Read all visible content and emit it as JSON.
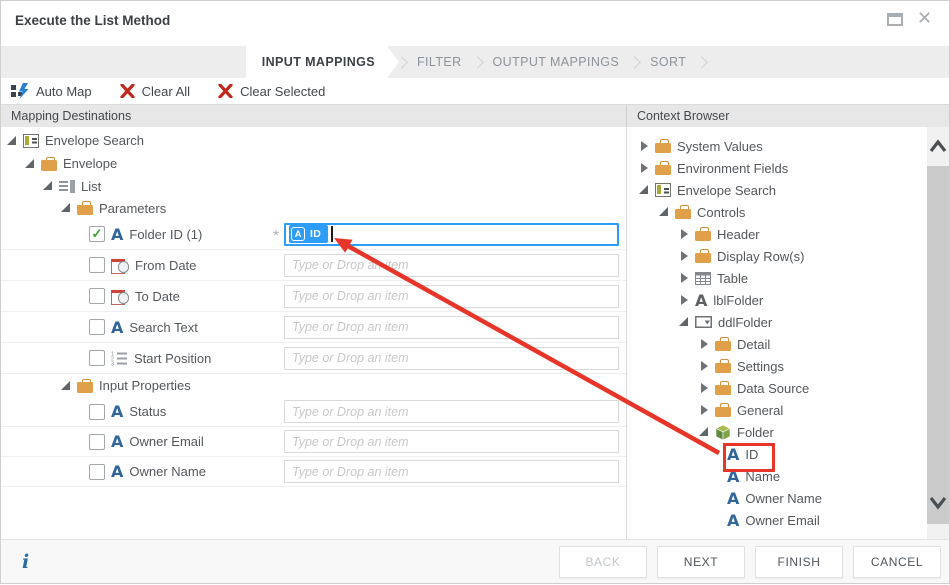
{
  "window": {
    "title": "Execute the List Method"
  },
  "tabs": {
    "items": [
      {
        "label": "INPUT MAPPINGS",
        "active": true
      },
      {
        "label": "FILTER",
        "active": false
      },
      {
        "label": "OUTPUT MAPPINGS",
        "active": false
      },
      {
        "label": "SORT",
        "active": false
      }
    ]
  },
  "toolbar": {
    "auto_map": "Auto Map",
    "clear_all": "Clear All",
    "clear_selected": "Clear Selected"
  },
  "left": {
    "header": "Mapping Destinations",
    "placeholder": "Type or Drop an item",
    "required_marker": "*",
    "chip": {
      "label": "ID"
    },
    "rows": [
      {
        "label": "Envelope Search"
      },
      {
        "label": "Envelope"
      },
      {
        "label": "List"
      },
      {
        "label": "Parameters"
      },
      {
        "label": "Folder ID (1)",
        "checked": true,
        "mapped_value": "ID"
      },
      {
        "label": "From Date",
        "checked": false
      },
      {
        "label": "To Date",
        "checked": false
      },
      {
        "label": "Search Text",
        "checked": false
      },
      {
        "label": "Start Position",
        "checked": false
      },
      {
        "label": "Input Properties"
      },
      {
        "label": "Status",
        "checked": false
      },
      {
        "label": "Owner Email",
        "checked": false
      },
      {
        "label": "Owner Name",
        "checked": false
      }
    ]
  },
  "right": {
    "header": "Context Browser",
    "items": [
      {
        "label": "System Values"
      },
      {
        "label": "Environment Fields"
      },
      {
        "label": "Envelope Search"
      },
      {
        "label": "Controls"
      },
      {
        "label": "Header"
      },
      {
        "label": "Display Row(s)"
      },
      {
        "label": "Table"
      },
      {
        "label": "lblFolder"
      },
      {
        "label": "ddlFolder"
      },
      {
        "label": "Detail"
      },
      {
        "label": "Settings"
      },
      {
        "label": "Data Source"
      },
      {
        "label": "General"
      },
      {
        "label": "Folder"
      },
      {
        "label": "ID",
        "highlighted": true
      },
      {
        "label": "Name"
      },
      {
        "label": "Owner Name"
      },
      {
        "label": "Owner Email"
      }
    ]
  },
  "footer": {
    "back": "BACK",
    "next": "NEXT",
    "finish": "FINISH",
    "cancel": "CANCEL"
  },
  "colors": {
    "accent_blue": "#2e9df7",
    "folder_orange": "#dfa049",
    "text_blue": "#33679b",
    "alert_red": "#e8352a",
    "toolbar_red": "#bf281c",
    "check_green": "#3f9c35"
  }
}
